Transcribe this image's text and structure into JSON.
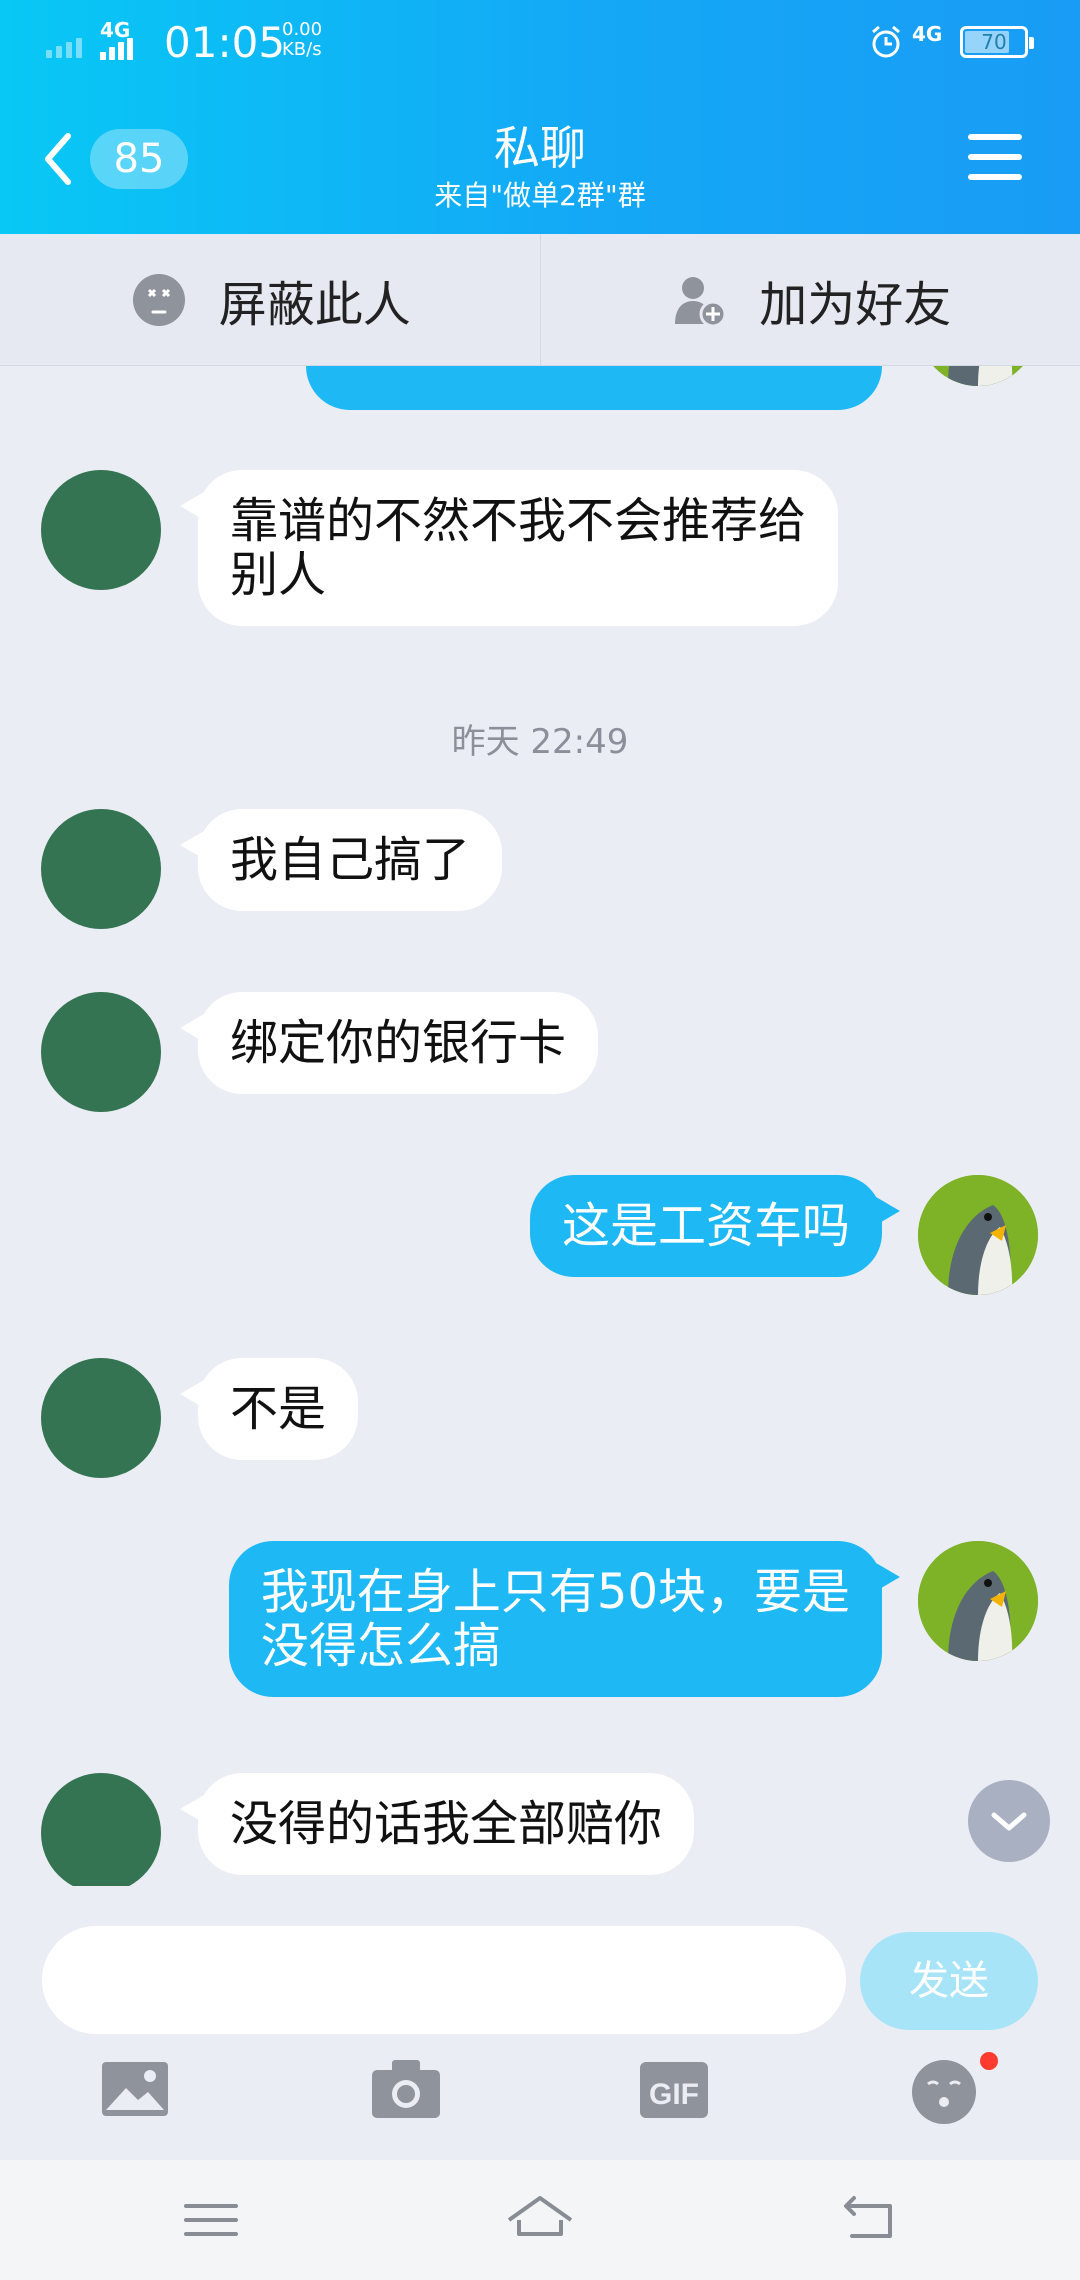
{
  "status_bar": {
    "network_left": "4G",
    "time": "01:05",
    "speed_value": "0.00",
    "speed_unit": "KB/s",
    "network_right": "4G",
    "battery": "70"
  },
  "header": {
    "back_count": "85",
    "title": "私聊",
    "subtitle": "来自\"做单2群\"群"
  },
  "actions": {
    "block_label": "屏蔽此人",
    "add_friend_label": "加为好友"
  },
  "messages": [
    {
      "side": "in",
      "lines": [
        "靠谱的不然不我不会推荐给",
        "别人"
      ]
    },
    {
      "timestamp": "昨天 22:49"
    },
    {
      "side": "in",
      "lines": [
        "我自己搞了"
      ]
    },
    {
      "side": "in",
      "lines": [
        "绑定你的银行卡"
      ]
    },
    {
      "side": "out",
      "lines": [
        "这是工资车吗"
      ]
    },
    {
      "side": "in",
      "lines": [
        "不是"
      ]
    },
    {
      "side": "out",
      "lines": [
        "我现在身上只有50块，要是",
        "没得怎么搞"
      ]
    },
    {
      "side": "in",
      "lines": [
        "没得的话我全部赔你"
      ]
    }
  ],
  "input": {
    "placeholder": "",
    "send_label": "发送"
  },
  "icons": {
    "image": "image-icon",
    "camera": "camera-icon",
    "gif": "gif-icon",
    "emoji": "emoji-icon"
  },
  "colors": {
    "header_start": "#08c8f5",
    "header_end": "#199cf5",
    "outgoing_bubble": "#1eb8f5",
    "incoming_bubble": "#ffffff",
    "chat_background": "#eaedf4"
  }
}
